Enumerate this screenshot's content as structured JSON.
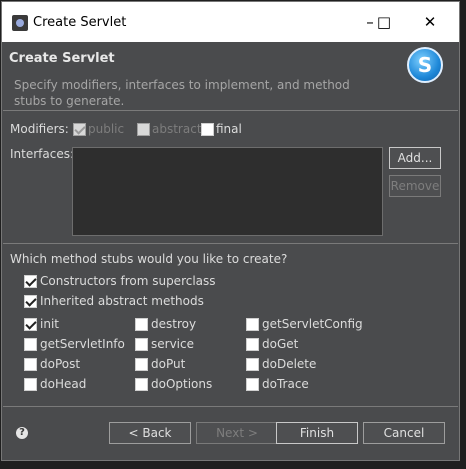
{
  "window": {
    "title": "Create Servlet"
  },
  "header": {
    "title": "Create Servlet",
    "description": "Specify modifiers, interfaces to implement, and method stubs to generate."
  },
  "modifiers": {
    "label": "Modifiers:",
    "public": {
      "label": "public",
      "checked": true,
      "disabled": true
    },
    "abstract": {
      "label": "abstract",
      "checked": false,
      "disabled": true
    },
    "final": {
      "label": "final",
      "checked": false,
      "disabled": false
    }
  },
  "interfaces": {
    "label": "Interfaces:",
    "add": "Add...",
    "remove": "Remove"
  },
  "stubs": {
    "question": "Which method stubs would you like to create?",
    "constructors": {
      "label": "Constructors from superclass",
      "checked": true
    },
    "inherited": {
      "label": "Inherited abstract methods",
      "checked": true
    },
    "methods": [
      {
        "label": "init",
        "checked": true
      },
      {
        "label": "destroy",
        "checked": false
      },
      {
        "label": "getServletConfig",
        "checked": false
      },
      {
        "label": "getServletInfo",
        "checked": false
      },
      {
        "label": "service",
        "checked": false
      },
      {
        "label": "doGet",
        "checked": false
      },
      {
        "label": "doPost",
        "checked": false
      },
      {
        "label": "doPut",
        "checked": false
      },
      {
        "label": "doDelete",
        "checked": false
      },
      {
        "label": "doHead",
        "checked": false
      },
      {
        "label": "doOptions",
        "checked": false
      },
      {
        "label": "doTrace",
        "checked": false
      }
    ]
  },
  "buttons": {
    "back": "< Back",
    "next": "Next >",
    "finish": "Finish",
    "cancel": "Cancel"
  },
  "icons": {
    "help": "help-icon",
    "logo": "servlet-wizard-logo",
    "app": "eclipse-app-icon"
  }
}
